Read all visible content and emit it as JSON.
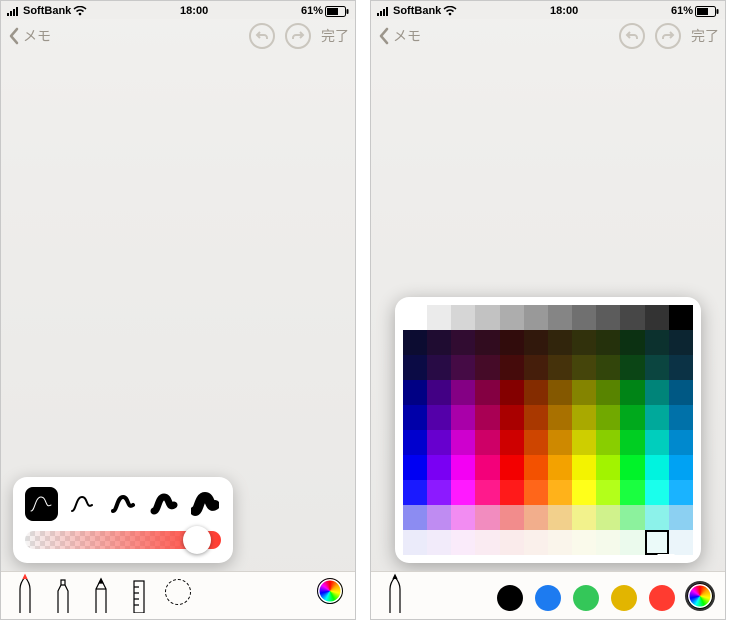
{
  "status": {
    "carrier": "SoftBank",
    "time": "18:00",
    "battery_pct": "61%"
  },
  "nav": {
    "back_label": "メモ",
    "done_label": "完了"
  },
  "icons": {
    "undo": "undo-icon",
    "redo": "redo-icon",
    "back_chevron": "chevron-left-icon",
    "signal": "signal-icon",
    "wifi": "wifi-icon",
    "battery": "battery-icon"
  },
  "left": {
    "stroke_popover": {
      "widths": [
        1,
        2,
        4,
        7,
        10
      ],
      "selected_index": 0,
      "opacity_slider": {
        "value": 0.88
      }
    },
    "tools": {
      "items": [
        "pen",
        "marker",
        "pencil",
        "ruler",
        "lasso"
      ],
      "selected": "pen",
      "pen_tip_color": "#ff3b30"
    },
    "color_wheel": true
  },
  "right": {
    "color_grid": {
      "rows": 10,
      "cols": 12,
      "greys": [
        "#ffffff",
        "#ebebeb",
        "#d6d6d6",
        "#c2c2c2",
        "#adadad",
        "#999999",
        "#858585",
        "#707070",
        "#5c5c5c",
        "#474747",
        "#333333",
        "#000000"
      ],
      "hues": [
        240,
        270,
        300,
        330,
        0,
        20,
        40,
        60,
        80,
        130,
        175,
        200
      ],
      "selected": {
        "row": 9,
        "col": 10
      }
    },
    "colors": {
      "swatches": [
        "#000000",
        "#1d7bf0",
        "#34c759",
        "#e2b500",
        "#ff3b30"
      ],
      "selected_tool": "pen"
    }
  }
}
